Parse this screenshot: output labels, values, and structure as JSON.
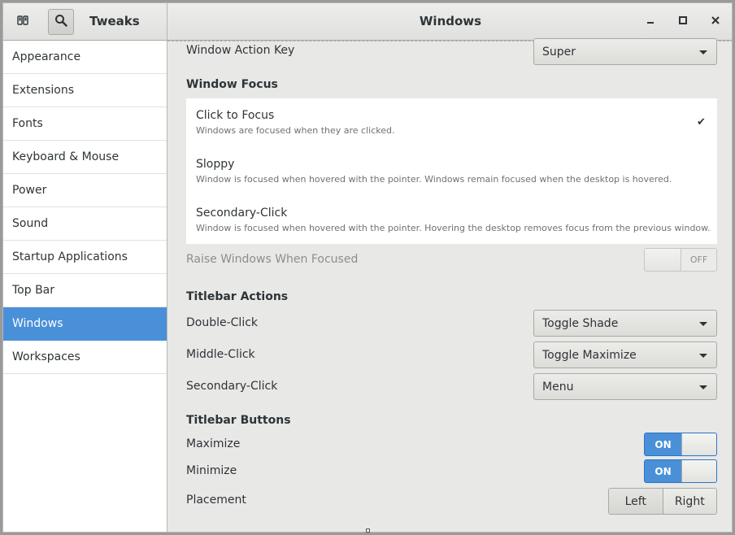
{
  "header": {
    "app_title": "Tweaks",
    "window_title": "Windows",
    "icons": [
      "tweaks-icon",
      "search-icon",
      "minimize-icon",
      "maximize-icon",
      "close-icon"
    ]
  },
  "sidebar": {
    "items": [
      {
        "label": "Appearance"
      },
      {
        "label": "Extensions"
      },
      {
        "label": "Fonts"
      },
      {
        "label": "Keyboard & Mouse"
      },
      {
        "label": "Power"
      },
      {
        "label": "Sound"
      },
      {
        "label": "Startup Applications"
      },
      {
        "label": "Top Bar"
      },
      {
        "label": "Windows",
        "selected": true
      },
      {
        "label": "Workspaces"
      }
    ]
  },
  "content": {
    "window_action_key": {
      "label": "Window Action Key",
      "value": "Super"
    },
    "window_focus": {
      "heading": "Window Focus",
      "options": [
        {
          "title": "Click to Focus",
          "description": "Windows are focused when they are clicked.",
          "selected": true
        },
        {
          "title": "Sloppy",
          "description": "Window is focused when hovered with the pointer. Windows remain focused when the desktop is hovered."
        },
        {
          "title": "Secondary-Click",
          "description": "Window is focused when hovered with the pointer. Hovering the desktop removes focus from the previous window."
        }
      ],
      "check_glyph": "✔"
    },
    "raise_windows": {
      "label": "Raise Windows When Focused",
      "state": "OFF"
    },
    "titlebar_actions": {
      "heading": "Titlebar Actions",
      "double_click": {
        "label": "Double-Click",
        "value": "Toggle Shade"
      },
      "middle_click": {
        "label": "Middle-Click",
        "value": "Toggle Maximize"
      },
      "secondary_click": {
        "label": "Secondary-Click",
        "value": "Menu"
      }
    },
    "titlebar_buttons": {
      "heading": "Titlebar Buttons",
      "maximize": {
        "label": "Maximize",
        "state": "ON"
      },
      "minimize": {
        "label": "Minimize",
        "state": "ON"
      },
      "placement": {
        "label": "Placement",
        "options": [
          "Left",
          "Right"
        ]
      }
    }
  },
  "colors": {
    "accent": "#4a90d9",
    "background": "#e8e8e7",
    "sidebar_bg": "#ffffff",
    "text": "#2e3436"
  }
}
